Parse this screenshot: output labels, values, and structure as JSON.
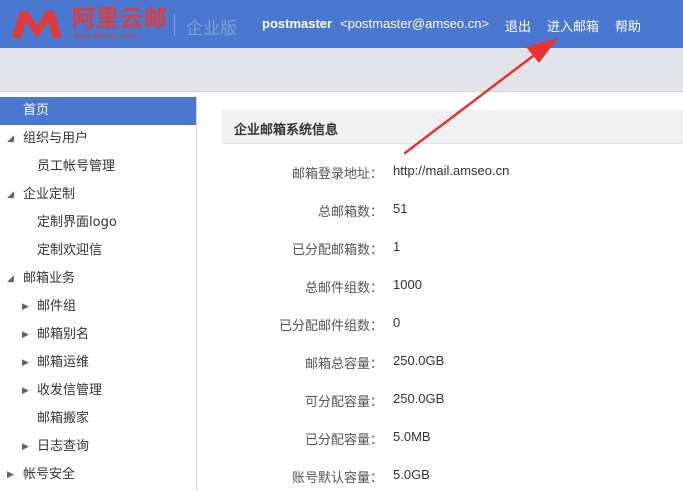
{
  "header": {
    "logo_text": "阿里云邮",
    "logo_sub": "qiye.aliyun.com",
    "edition": "企业版",
    "user_name": "postmaster",
    "user_email": "<postmaster@amseo.cn>",
    "logout": "退出",
    "enter_mailbox": "进入邮箱",
    "help": "帮助"
  },
  "sidebar": {
    "items": [
      {
        "label": "首页"
      },
      {
        "label": "组织与用户"
      },
      {
        "label": "员工帐号管理"
      },
      {
        "label": "企业定制"
      },
      {
        "label": "定制界面logo"
      },
      {
        "label": "定制欢迎信"
      },
      {
        "label": "邮箱业务"
      },
      {
        "label": "邮件组"
      },
      {
        "label": "邮箱别名"
      },
      {
        "label": "邮箱运维"
      },
      {
        "label": "收发信管理"
      },
      {
        "label": "邮箱搬家"
      },
      {
        "label": "日志查询"
      },
      {
        "label": "帐号安全"
      }
    ]
  },
  "main": {
    "panel_title": "企业邮箱系统信息",
    "rows": [
      {
        "key": "邮箱登录地址：",
        "value": "http://mail.amseo.cn"
      },
      {
        "key": "总邮箱数：",
        "value": "51"
      },
      {
        "key": "已分配邮箱数：",
        "value": "1"
      },
      {
        "key": "总邮件组数：",
        "value": "1000"
      },
      {
        "key": "已分配邮件组数：",
        "value": "0"
      },
      {
        "key": "邮箱总容量：",
        "value": "250.0GB"
      },
      {
        "key": "可分配容量：",
        "value": "250.0GB"
      },
      {
        "key": "已分配容量：",
        "value": "5.0MB"
      },
      {
        "key": "账号默认容量：",
        "value": "5.0GB"
      }
    ]
  },
  "colors": {
    "header_bg": "#4a78d0",
    "logo_red": "#e03a3a",
    "active_bg": "#4a78d0",
    "arrow_red": "#e8322e"
  }
}
